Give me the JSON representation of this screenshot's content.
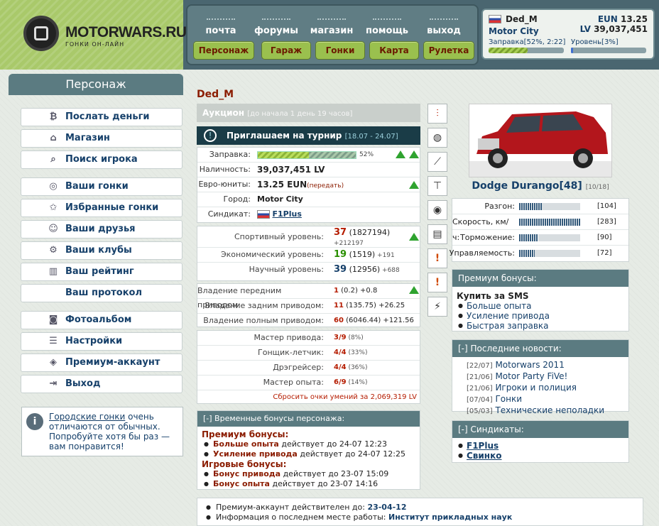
{
  "logo": {
    "text": "MOTORWARS.RU",
    "sub": "ГОНКИ ОН-ЛАЙН"
  },
  "topnav": {
    "links": [
      "почта",
      "форумы",
      "магазин",
      "помощь",
      "выход"
    ],
    "buttons": [
      "Персонаж",
      "Гараж",
      "Гонки",
      "Карта",
      "Рулетка"
    ]
  },
  "user": {
    "name": "Ded_M",
    "city": "Motor City",
    "eun_label": "EUN",
    "eun": "13.25",
    "lv_label": "LV",
    "lv": "39,037,451",
    "fuel_label": "Заправка[52%, 2:22]",
    "fuel_pct": 52,
    "level_label": "Уровень[3%]",
    "level_pct": 3
  },
  "sidebar": {
    "title": "Персонаж",
    "items": [
      "Послать деньги",
      "Магазин",
      "Поиск игрока",
      "Ваши гонки",
      "Избранные гонки",
      "Ваши друзья",
      "Ваши клубы",
      "Ваш рейтинг",
      "Ваш протокол",
      "Фотоальбом",
      "Настройки",
      "Премиум-аккаунт",
      "Выход"
    ],
    "info_link": "Городские гонки",
    "info_text": " очень отличаются от обычных. Попробуйте хотя бы раз — вам понравится!"
  },
  "player": {
    "name": "Ded_M"
  },
  "auction": {
    "title": "Аукцион",
    "note": "[до начала 1 день 19 часов]"
  },
  "tournament": {
    "title": "Приглашаем на турнир",
    "dates": "[18.07 - 24.07]"
  },
  "stats": {
    "fuel_label": "Заправка:",
    "fuel_pct": 52,
    "fuel_text": "52%",
    "cash_label": "Наличность:",
    "cash": "39,037,451 LV",
    "euro_label": "Евро-юниты:",
    "euro": "13.25 EUN",
    "euro_link": "(передать)",
    "city_label": "Город:",
    "city": "Motor City",
    "synd_label": "Синдикат:",
    "synd": "F1Plus"
  },
  "levels": [
    {
      "label": "Спортивный уровень:",
      "value": "37",
      "sub": " (1827194)",
      "extra": "+212197"
    },
    {
      "label": "Экономический уровень:",
      "value": "19",
      "sub": " (1519)",
      "extra": " +191"
    },
    {
      "label": "Научный уровень:",
      "value": "39",
      "sub": " (12956)",
      "extra": " +688"
    }
  ],
  "drives": [
    {
      "label": "Владение передним приводом:",
      "value": "1",
      "sub": " (0.2) +0.8"
    },
    {
      "label": "Владение задним приводом:",
      "value": "11",
      "sub": " (135.75) +26.25"
    },
    {
      "label": "Владение полным приводом:",
      "value": "60",
      "sub": " (6046.44) +121.56"
    }
  ],
  "skills": [
    {
      "label": "Мастер привода:",
      "value": "3/9",
      "sub": " (8%)"
    },
    {
      "label": "Гонщик-летчик:",
      "value": "4/4",
      "sub": " (33%)"
    },
    {
      "label": "Дрэгрейсер:",
      "value": "4/4",
      "sub": " (36%)"
    },
    {
      "label": "Мастер опыта:",
      "value": "6/9",
      "sub": " (14%)"
    }
  ],
  "reset_text": "Сбросить очки умений за 2,069,319 LV",
  "temp_bonus": {
    "title": "[-]  Временные бонусы персонажа:",
    "premium_title": "Премиум бонусы:",
    "premium": [
      {
        "name": "Больше опыта",
        "text": " действует до 24-07 12:23"
      },
      {
        "name": "Усиление привода",
        "text": " действует до 24-07 12:25"
      }
    ],
    "game_title": "Игровые бонусы:",
    "game": [
      {
        "name": "Бонус привода",
        "text": " действует до 23-07 15:09"
      },
      {
        "name": "Бонус опыта",
        "text": " действует до 23-07 14:16"
      }
    ]
  },
  "car": {
    "name": "Dodge Durango[48]",
    "slots": "[10/18]",
    "stats": [
      {
        "label": "Разгон:",
        "value": 104,
        "text": "[104]"
      },
      {
        "label": "Скорость, км/ч:",
        "value": 283,
        "text": "[283]"
      },
      {
        "label": "Торможение:",
        "value": 90,
        "text": "[90]"
      },
      {
        "label": "Управляемость:",
        "value": 72,
        "text": "[72]"
      }
    ]
  },
  "premium_box": {
    "title": "Премиум бонусы:",
    "buy": "Купить за SMS",
    "items": [
      "Больше опыта",
      "Усиление привода",
      "Быстрая заправка"
    ]
  },
  "news": {
    "title": "[-]  Последние новости:",
    "items": [
      {
        "date": "[22/07]",
        "text": " Motorwars 2011"
      },
      {
        "date": "[21/06]",
        "text": " Motor Party FiVe!"
      },
      {
        "date": "[21/06]",
        "text": " Игроки и полиция"
      },
      {
        "date": "[07/04]",
        "text": " Гонки"
      },
      {
        "date": "[05/03]",
        "text": " Технические неполадки"
      }
    ]
  },
  "syndicates": {
    "title": "[-]  Синдикаты:",
    "items": [
      "F1Plus",
      "Свинко"
    ]
  },
  "bottom": {
    "premium_label": "Премиум-аккаунт действителен до: ",
    "premium_date": "23-04-12",
    "work_label": "Информация о последнем месте работы: ",
    "work": "Институт прикладных наук"
  },
  "colors": {
    "accent": "#16406a",
    "brand_red": "#8b1c00",
    "header": "#5b7b81",
    "green_btn": "#9ac04e"
  }
}
